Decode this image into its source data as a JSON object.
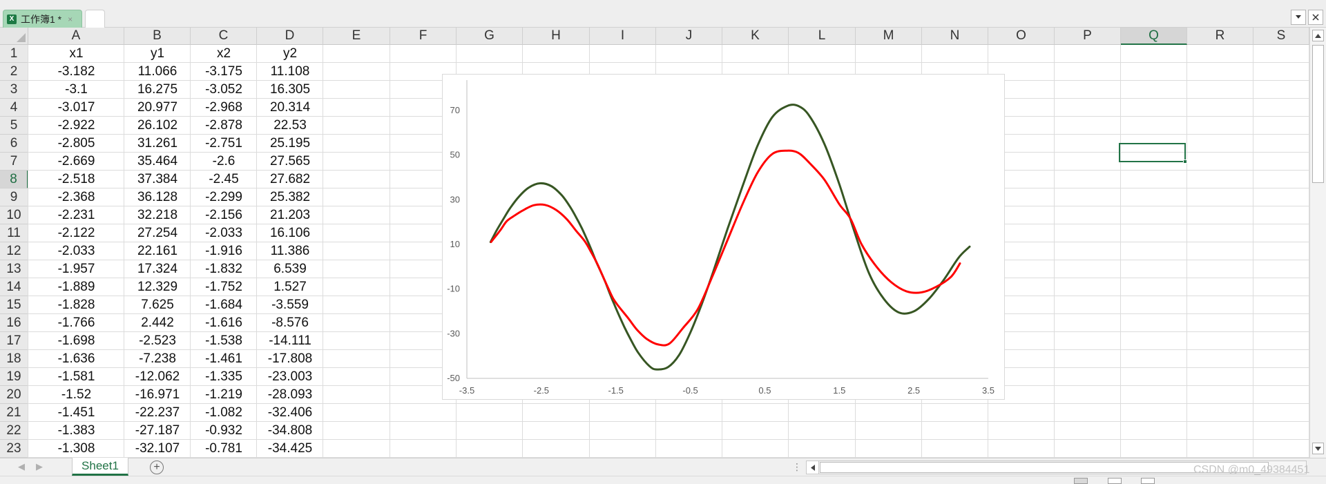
{
  "tabbar": {
    "workbook_tab": "工作簿1 *",
    "close_glyph": "×",
    "icon_glyph": "X"
  },
  "columns": [
    "A",
    "B",
    "C",
    "D",
    "E",
    "F",
    "G",
    "H",
    "I",
    "J",
    "K",
    "L",
    "M",
    "N",
    "O",
    "P",
    "Q",
    "R",
    "S"
  ],
  "selected_column": "Q",
  "rows": [
    "1",
    "2",
    "3",
    "4",
    "5",
    "6",
    "7",
    "8",
    "9",
    "10",
    "11",
    "12",
    "13",
    "14",
    "15",
    "16",
    "17",
    "18",
    "19",
    "20",
    "21",
    "22",
    "23"
  ],
  "selected_row": "8",
  "table": {
    "headers": [
      "x1",
      "y1",
      "x2",
      "y2"
    ],
    "cells": [
      [
        "-3.182",
        "11.066",
        "-3.175",
        "11.108"
      ],
      [
        "-3.1",
        "16.275",
        "-3.052",
        "16.305"
      ],
      [
        "-3.017",
        "20.977",
        "-2.968",
        "20.314"
      ],
      [
        "-2.922",
        "26.102",
        "-2.878",
        "22.53"
      ],
      [
        "-2.805",
        "31.261",
        "-2.751",
        "25.195"
      ],
      [
        "-2.669",
        "35.464",
        "-2.6",
        "27.565"
      ],
      [
        "-2.518",
        "37.384",
        "-2.45",
        "27.682"
      ],
      [
        "-2.368",
        "36.128",
        "-2.299",
        "25.382"
      ],
      [
        "-2.231",
        "32.218",
        "-2.156",
        "21.203"
      ],
      [
        "-2.122",
        "27.254",
        "-2.033",
        "16.106"
      ],
      [
        "-2.033",
        "22.161",
        "-1.916",
        "11.386"
      ],
      [
        "-1.957",
        "17.324",
        "-1.832",
        "6.539"
      ],
      [
        "-1.889",
        "12.329",
        "-1.752",
        "1.527"
      ],
      [
        "-1.828",
        "7.625",
        "-1.684",
        "-3.559"
      ],
      [
        "-1.766",
        "2.442",
        "-1.616",
        "-8.576"
      ],
      [
        "-1.698",
        "-2.523",
        "-1.538",
        "-14.111"
      ],
      [
        "-1.636",
        "-7.238",
        "-1.461",
        "-17.808"
      ],
      [
        "-1.581",
        "-12.062",
        "-1.335",
        "-23.003"
      ],
      [
        "-1.52",
        "-16.971",
        "-1.219",
        "-28.093"
      ],
      [
        "-1.451",
        "-22.237",
        "-1.082",
        "-32.406"
      ],
      [
        "-1.383",
        "-27.187",
        "-0.932",
        "-34.808"
      ],
      [
        "-1.308",
        "-32.107",
        "-0.781",
        "-34.425"
      ]
    ]
  },
  "chart_data": {
    "type": "scatter",
    "title": "",
    "xlabel": "",
    "ylabel": "",
    "xlim": [
      -3.5,
      3.5
    ],
    "ylim": [
      -50,
      80
    ],
    "xticks": [
      "-3.5",
      "-2.5",
      "-1.5",
      "-0.5",
      "0.5",
      "1.5",
      "2.5",
      "3.5"
    ],
    "yticks": [
      "70",
      "50",
      "30",
      "10",
      "-10",
      "-30",
      "-50"
    ],
    "grid": false,
    "legend": "none",
    "series": [
      {
        "color": "#375623",
        "x": [
          -3.182,
          -3.1,
          -3.017,
          -2.922,
          -2.805,
          -2.669,
          -2.518,
          -2.368,
          -2.231,
          -2.122,
          -2.033,
          -1.957,
          -1.889,
          -1.828,
          -1.766,
          -1.698,
          -1.636,
          -1.581,
          -1.52,
          -1.451,
          -1.383,
          -1.308,
          -1.2,
          -1.05,
          -0.95,
          -0.8,
          -0.65,
          -0.5,
          -0.35,
          -0.2,
          0.0,
          0.2,
          0.4,
          0.6,
          0.8,
          0.95,
          1.1,
          1.3,
          1.5,
          1.7,
          1.9,
          2.1,
          2.3,
          2.5,
          2.7,
          2.9,
          3.1,
          3.25
        ],
        "y": [
          11.066,
          16.275,
          20.977,
          26.102,
          31.261,
          35.464,
          37.384,
          36.128,
          32.218,
          27.254,
          22.161,
          17.324,
          12.329,
          7.625,
          2.442,
          -2.523,
          -7.238,
          -12.062,
          -16.971,
          -22.237,
          -27.187,
          -32.107,
          -38.5,
          -44.5,
          -46.0,
          -45.0,
          -39.5,
          -29.5,
          -17.0,
          -3.0,
          17.0,
          36.0,
          54.0,
          67.0,
          72.0,
          72.0,
          67.5,
          55.0,
          37.0,
          16.0,
          -3.0,
          -14.5,
          -20.5,
          -20.0,
          -14.5,
          -6.0,
          4.0,
          9.0
        ]
      },
      {
        "color": "#ff0000",
        "x": [
          -3.175,
          -3.052,
          -2.968,
          -2.878,
          -2.751,
          -2.6,
          -2.45,
          -2.299,
          -2.156,
          -2.033,
          -1.916,
          -1.832,
          -1.752,
          -1.684,
          -1.616,
          -1.538,
          -1.461,
          -1.335,
          -1.219,
          -1.082,
          -0.932,
          -0.781,
          -0.6,
          -0.4,
          -0.2,
          0.0,
          0.2,
          0.4,
          0.6,
          0.8,
          0.95,
          1.1,
          1.3,
          1.5,
          1.65,
          1.8,
          2.0,
          2.2,
          2.4,
          2.6,
          2.8,
          3.0,
          3.12
        ],
        "y": [
          11.108,
          16.305,
          20.314,
          22.53,
          25.195,
          27.565,
          27.682,
          25.382,
          21.203,
          16.106,
          11.386,
          6.539,
          1.527,
          -3.559,
          -8.576,
          -14.111,
          -17.808,
          -23.003,
          -28.093,
          -32.406,
          -34.808,
          -34.425,
          -27.5,
          -19.0,
          -4.0,
          12.0,
          28.0,
          42.0,
          50.5,
          52.0,
          51.0,
          46.5,
          39.0,
          28.0,
          21.5,
          10.0,
          0.0,
          -7.0,
          -11.0,
          -11.5,
          -9.0,
          -4.5,
          1.5
        ]
      }
    ]
  },
  "sheetbar": {
    "sheet_tab": "Sheet1",
    "add_glyph": "+",
    "split_glyph": "⋮",
    "nav_prev": "◀",
    "nav_next": "▶",
    "watermark": "CSDN @m0_49384451"
  }
}
